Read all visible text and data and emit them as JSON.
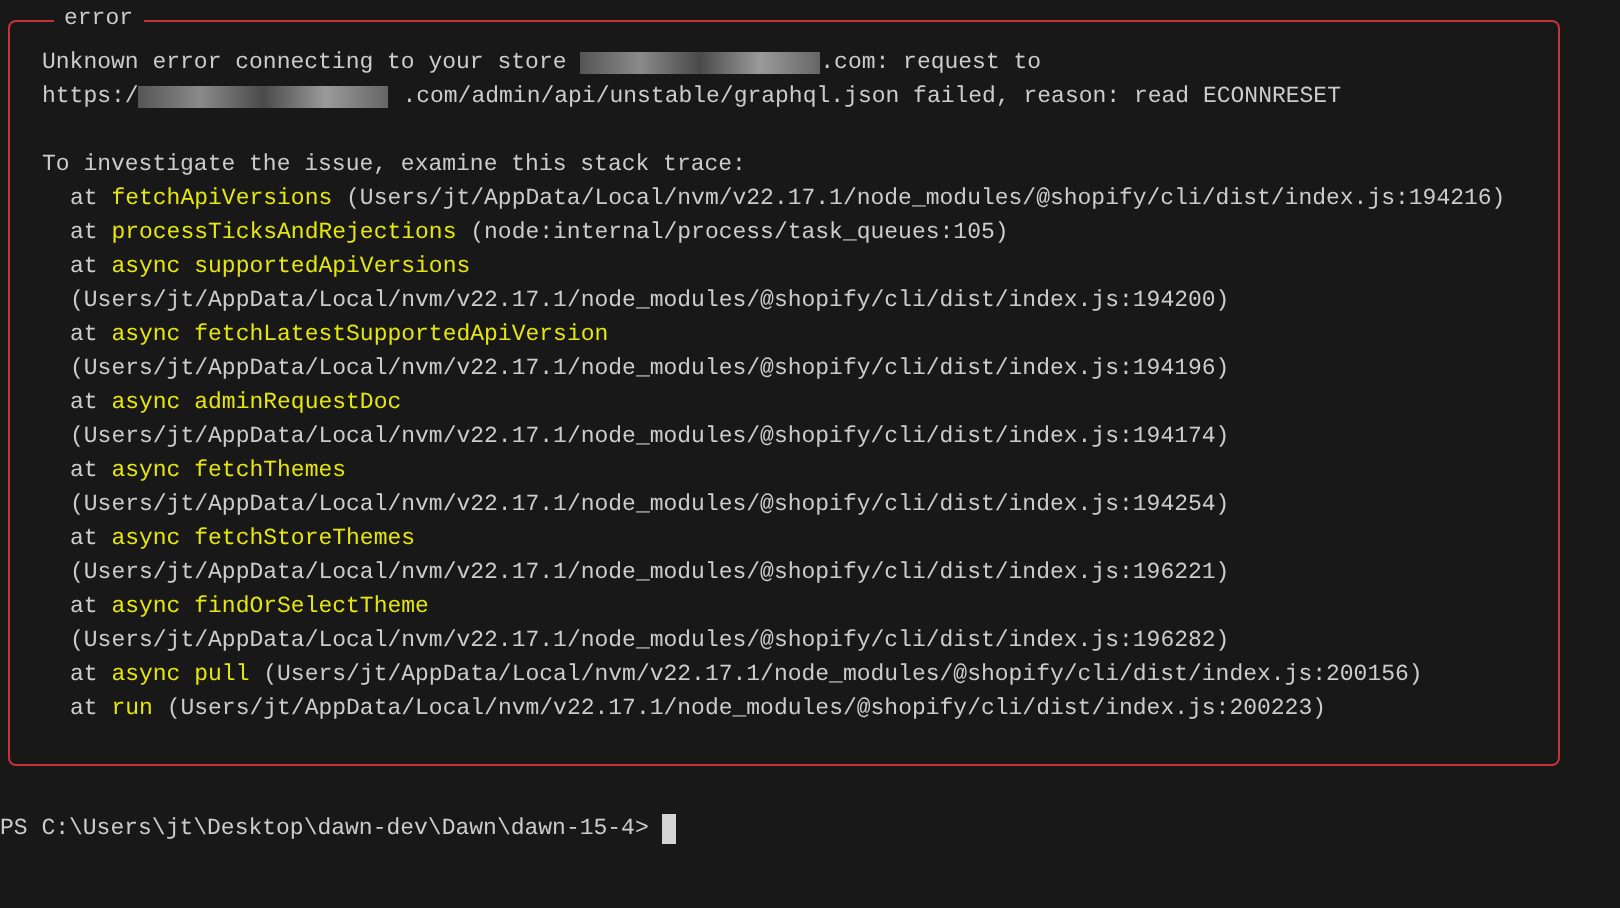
{
  "error_box": {
    "title": "error",
    "message_lines": [
      {
        "before": "Unknown error connecting to your store",
        "after": ".com: request to"
      },
      {
        "before": "https:/",
        "after": ".com/admin/api/unstable/graphql.json failed, reason: read ECONNRESET"
      }
    ],
    "hint": "To investigate the issue, examine this stack trace:",
    "stack_frames": [
      {
        "at": "at",
        "call": "fetchApiVersions",
        "location": "(Users/jt/AppData/Local/nvm/v22.17.1/node_modules/@shopify/cli/dist/index.js:194216)",
        "wrapped": false
      },
      {
        "at": "at",
        "call": "processTicksAndRejections",
        "location": "(node:internal/process/task_queues:105)",
        "wrapped": false
      },
      {
        "at": "at",
        "call": "async supportedApiVersions",
        "location": "(Users/jt/AppData/Local/nvm/v22.17.1/node_modules/@shopify/cli/dist/index.js:194200)",
        "wrapped": true
      },
      {
        "at": "at",
        "call": "async fetchLatestSupportedApiVersion",
        "location": "(Users/jt/AppData/Local/nvm/v22.17.1/node_modules/@shopify/cli/dist/index.js:194196)",
        "wrapped": true
      },
      {
        "at": "at",
        "call": "async adminRequestDoc",
        "location": "(Users/jt/AppData/Local/nvm/v22.17.1/node_modules/@shopify/cli/dist/index.js:194174)",
        "wrapped": true
      },
      {
        "at": "at",
        "call": "async fetchThemes",
        "location": "(Users/jt/AppData/Local/nvm/v22.17.1/node_modules/@shopify/cli/dist/index.js:194254)",
        "wrapped": true
      },
      {
        "at": "at",
        "call": "async fetchStoreThemes",
        "location": "(Users/jt/AppData/Local/nvm/v22.17.1/node_modules/@shopify/cli/dist/index.js:196221)",
        "wrapped": true
      },
      {
        "at": "at",
        "call": "async findOrSelectTheme",
        "location": "(Users/jt/AppData/Local/nvm/v22.17.1/node_modules/@shopify/cli/dist/index.js:196282)",
        "wrapped": true
      },
      {
        "at": "at",
        "call": "async pull",
        "location": "(Users/jt/AppData/Local/nvm/v22.17.1/node_modules/@shopify/cli/dist/index.js:200156)",
        "wrapped": false
      },
      {
        "at": "at",
        "call": "run",
        "location": "(Users/jt/AppData/Local/nvm/v22.17.1/node_modules/@shopify/cli/dist/index.js:200223)",
        "wrapped": false
      }
    ]
  },
  "prompt": "PS C:\\Users\\jt\\Desktop\\dawn-dev\\Dawn\\dawn-15-4>"
}
